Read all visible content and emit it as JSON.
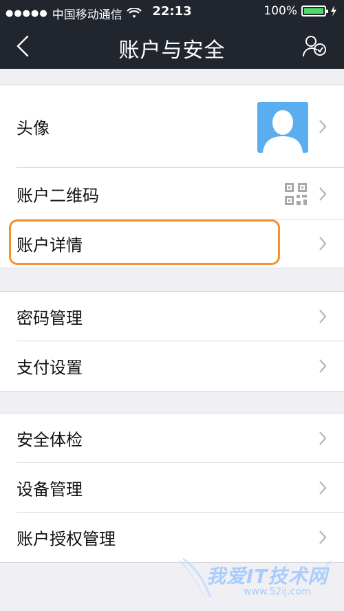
{
  "status_bar": {
    "carrier": "中国移动通信",
    "time": "22:13",
    "battery": "100%"
  },
  "nav": {
    "title": "账户与安全"
  },
  "groups": [
    {
      "items": [
        {
          "label": "头像"
        },
        {
          "label": "账户二维码"
        },
        {
          "label": "账户详情"
        }
      ]
    },
    {
      "items": [
        {
          "label": "密码管理"
        },
        {
          "label": "支付设置"
        }
      ]
    },
    {
      "items": [
        {
          "label": "安全体检"
        },
        {
          "label": "设备管理"
        },
        {
          "label": "账户授权管理"
        }
      ]
    }
  ],
  "watermark": {
    "text": "我爱IT技术网",
    "url": "www.52ij.com"
  },
  "colors": {
    "nav_bg": "#20252e",
    "avatar_bg": "#5aaef0",
    "highlight": "#f39229",
    "battery": "#4cd964"
  }
}
